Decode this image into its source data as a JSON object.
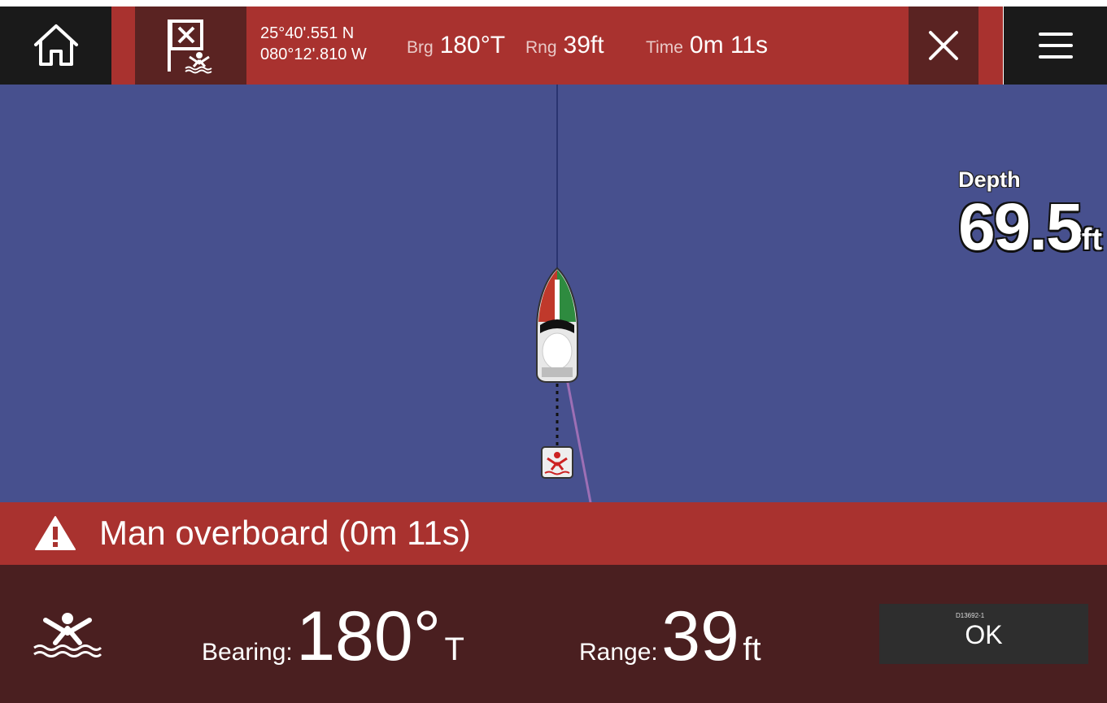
{
  "top_bar": {
    "home_icon": "home-icon",
    "mob_icon": "mob-flag-icon",
    "latitude": "25°40'.551 N",
    "longitude": "080°12'.810 W",
    "brg_label": "Brg",
    "brg_value": "180°T",
    "rng_label": "Rng",
    "rng_value": "39ft",
    "time_label": "Time",
    "time_value": "0m 11s",
    "close_icon": "close-icon",
    "menu_icon": "menu-icon"
  },
  "chart": {
    "depth_label": "Depth",
    "depth_value": "69.5",
    "depth_unit": "ft"
  },
  "alert": {
    "icon": "warning-icon",
    "text": "Man overboard (0m 11s)"
  },
  "bottom": {
    "icon": "man-overboard-icon",
    "bearing_label": "Bearing:",
    "bearing_value": "180°",
    "bearing_unit": "T",
    "range_label": "Range:",
    "range_value": "39",
    "range_unit": "ft",
    "ok_code": "D13692-1",
    "ok_label": "OK"
  },
  "colors": {
    "sea": "#47508e",
    "alert_red": "#a9322f",
    "panel_dark": "#4a1f20",
    "button_dark": "#1a1a1a"
  }
}
